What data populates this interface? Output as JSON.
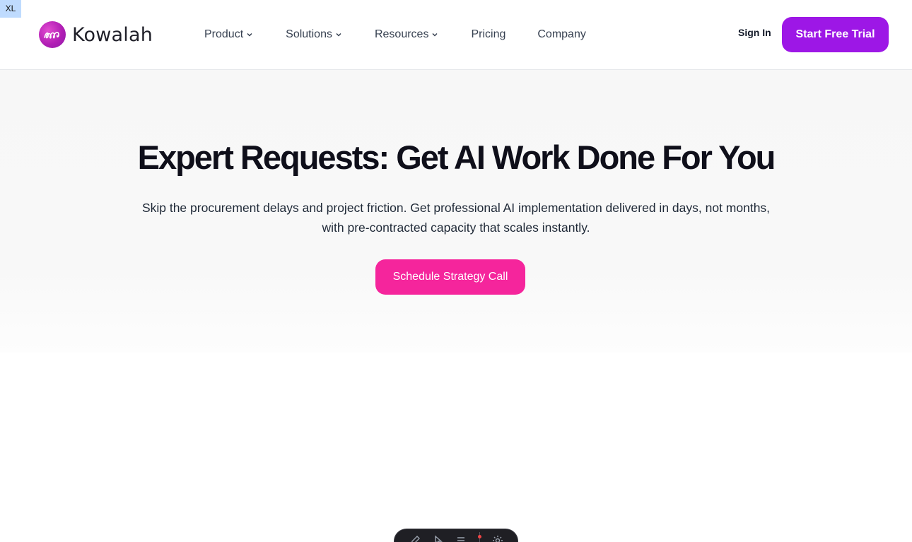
{
  "badge": {
    "label": "XL"
  },
  "brand": {
    "name": "Kowalah",
    "logo_icon": "kowalah-swirl-icon",
    "color": "#b21fb5"
  },
  "nav": {
    "items": [
      {
        "label": "Product",
        "has_dropdown": true
      },
      {
        "label": "Solutions",
        "has_dropdown": true
      },
      {
        "label": "Resources",
        "has_dropdown": true
      },
      {
        "label": "Pricing",
        "has_dropdown": false
      },
      {
        "label": "Company",
        "has_dropdown": false
      }
    ],
    "dropdown_icon": "chevron-down-icon"
  },
  "auth": {
    "sign_in_label": "Sign In",
    "trial_label": "Start Free Trial",
    "trial_color": "#9d17e6"
  },
  "hero": {
    "title": "Expert Requests: Get AI Work Done For You",
    "subtitle": "Skip the procurement delays and project friction. Get professional AI implementation delivered in days, not months, with pre-contracted capacity that scales instantly.",
    "cta_label": "Schedule Strategy Call",
    "cta_color": "#f5259c"
  },
  "dock": {
    "icons": [
      "pen-icon",
      "pointer-icon",
      "list-icon",
      "gear-icon"
    ],
    "background": "#1f1f24"
  }
}
